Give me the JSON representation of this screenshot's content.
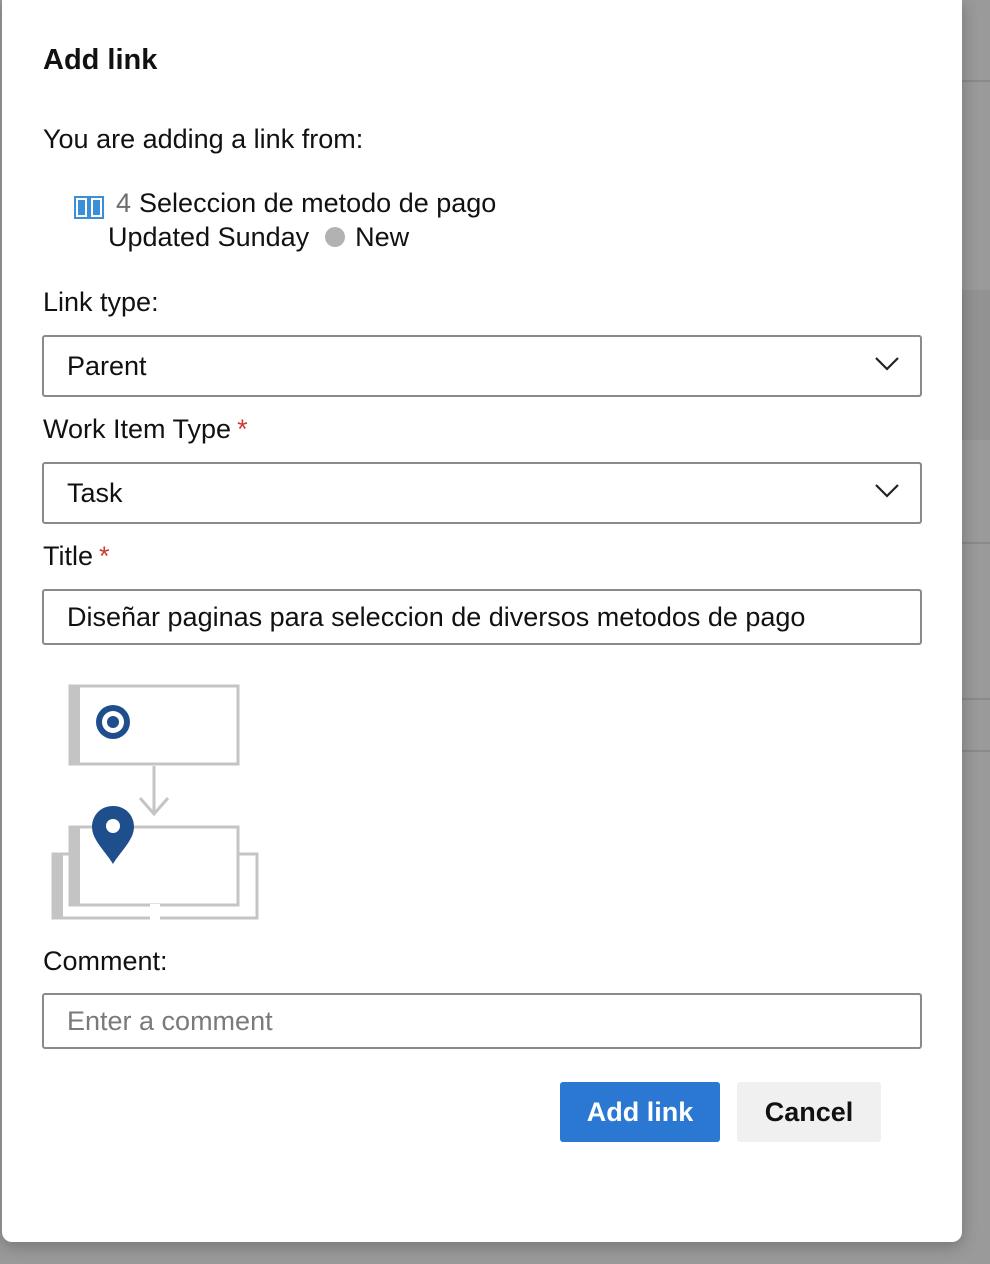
{
  "dialog": {
    "title": "Add link",
    "from_label": "You are adding a link from:"
  },
  "source_item": {
    "icon": "book-icon",
    "id": "4",
    "title": "Seleccion de metodo de pago",
    "updated": "Updated Sunday",
    "state": "New",
    "state_color": "#b2b2b2",
    "icon_color": "#3a8fd6"
  },
  "link_type": {
    "label": "Link type:",
    "value": "Parent"
  },
  "work_item_type": {
    "label": "Work Item Type",
    "required_mark": "*",
    "value": "Task"
  },
  "title_field": {
    "label": "Title",
    "required_mark": "*",
    "value": "Diseñar paginas para seleccion de diversos metodos de pago"
  },
  "diagram": {
    "top_icon": "target-icon",
    "bottom_icon": "map-pin-icon",
    "accent_color": "#1f4e8c"
  },
  "comment": {
    "label": "Comment:",
    "placeholder": "Enter a comment",
    "value": ""
  },
  "buttons": {
    "primary_label": "Add link",
    "secondary_label": "Cancel",
    "primary_color": "#2b78d2"
  }
}
